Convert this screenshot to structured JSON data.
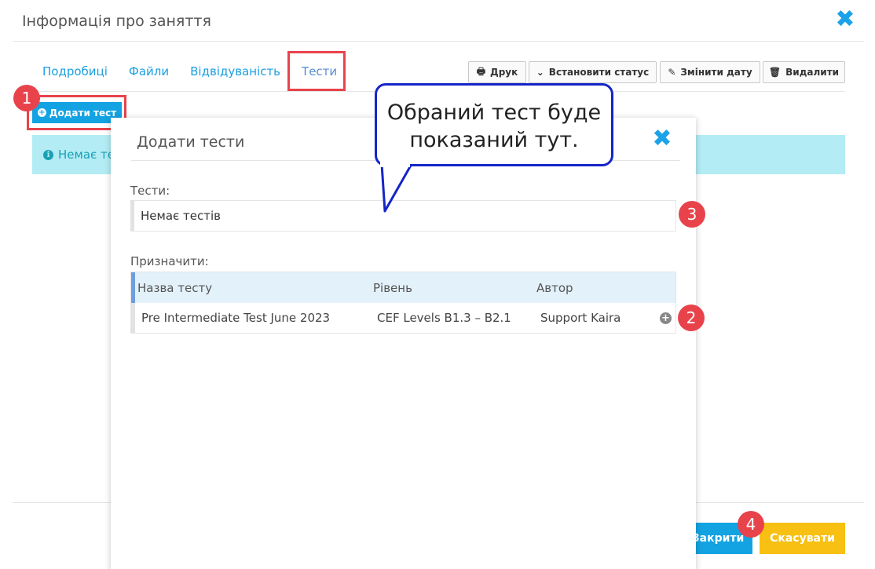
{
  "outer": {
    "title": "Інформація про заняття",
    "tabs": [
      {
        "label": "Подробиці"
      },
      {
        "label": "Файли"
      },
      {
        "label": "Відвідуваність"
      },
      {
        "label": "Тести"
      }
    ],
    "toolbar": {
      "print_label": "Друк",
      "set_status_label": "Встановити статус",
      "change_date_label": "Змінити дату",
      "delete_label": "Видалити"
    },
    "add_test_label": "Додати тест",
    "info_message": "Немає те",
    "close_label": "Закрити",
    "cancel_label": "Скасувати"
  },
  "inner": {
    "title": "Додати тести",
    "tests_label": "Тести:",
    "tests_empty": "Немає тестів",
    "assign_label": "Призначити:",
    "table": {
      "headers": [
        "Назва тесту",
        "Рівень",
        "Автор"
      ],
      "rows": [
        [
          "Pre Intermediate Test June 2023",
          "CEF Levels B1.3 – B2.1",
          "Support Kaira"
        ]
      ]
    }
  },
  "callout": {
    "line1": "Обраний тест буде",
    "line2": "показаний тут."
  },
  "badges": [
    "1",
    "2",
    "3",
    "4"
  ],
  "colors": {
    "accent_blue": "#13a3e2",
    "highlight_red": "#e8434b",
    "cancel_yellow": "#f7c012",
    "info_bg": "#b3ecf4",
    "callout_border": "#1525c8"
  }
}
